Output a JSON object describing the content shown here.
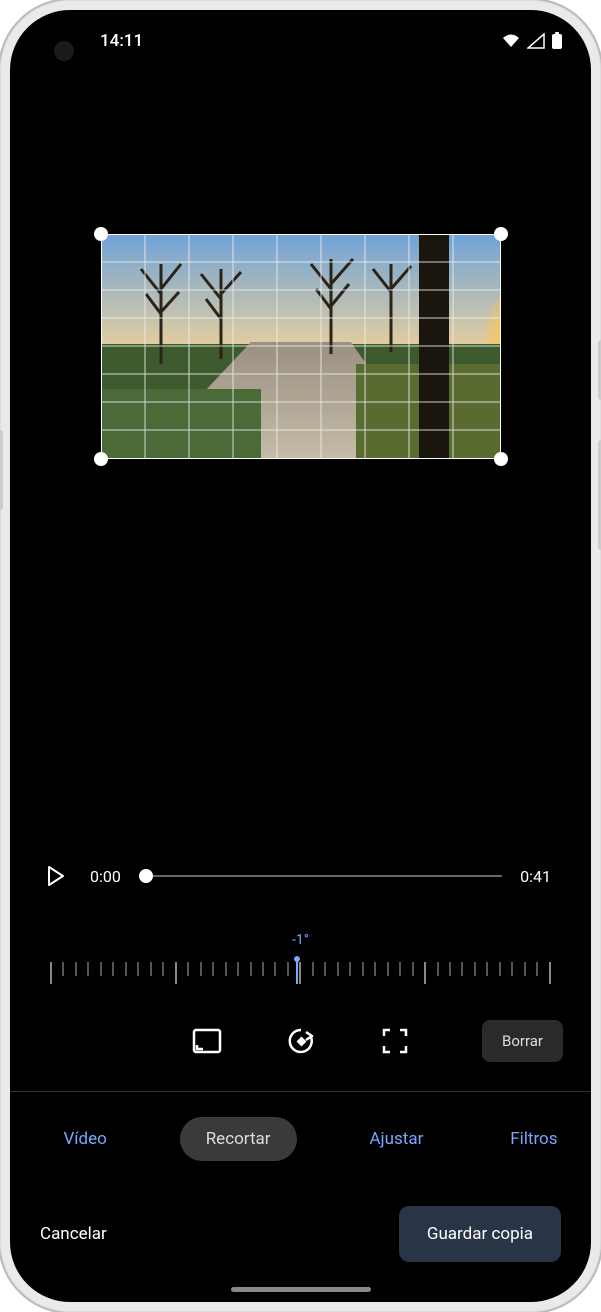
{
  "status": {
    "time": "14:11"
  },
  "playback": {
    "current": "0:00",
    "total": "0:41"
  },
  "rotation": {
    "label": "-1°",
    "value": -1
  },
  "tools": {
    "clear": "Borrar"
  },
  "tabs": {
    "video": "Vídeo",
    "crop": "Recortar",
    "adjust": "Ajustar",
    "filters": "Filtros"
  },
  "actions": {
    "cancel": "Cancelar",
    "save": "Guardar copia"
  }
}
